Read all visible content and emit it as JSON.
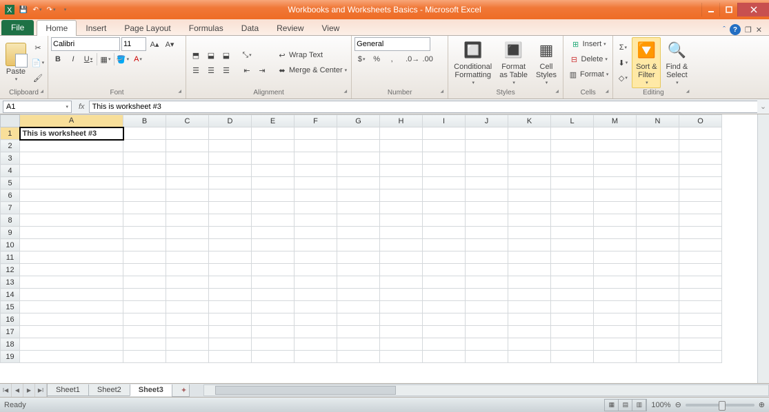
{
  "title": "Workbooks and Worksheets Basics - Microsoft Excel",
  "tabs": {
    "file": "File",
    "home": "Home",
    "insert": "Insert",
    "pagelayout": "Page Layout",
    "formulas": "Formulas",
    "data": "Data",
    "review": "Review",
    "view": "View"
  },
  "ribbon": {
    "clipboard": {
      "label": "Clipboard",
      "paste": "Paste"
    },
    "font": {
      "label": "Font",
      "name": "Calibri",
      "size": "11",
      "b": "B",
      "i": "I",
      "u": "U"
    },
    "alignment": {
      "label": "Alignment",
      "wrap": "Wrap Text",
      "merge": "Merge & Center"
    },
    "number": {
      "label": "Number",
      "format": "General",
      "currency": "$",
      "percent": "%",
      "comma": ","
    },
    "styles": {
      "label": "Styles",
      "cond": "Conditional\nFormatting",
      "table": "Format\nas Table",
      "cell": "Cell\nStyles"
    },
    "cells": {
      "label": "Cells",
      "insert": "Insert",
      "delete": "Delete",
      "format": "Format"
    },
    "editing": {
      "label": "Editing",
      "sort": "Sort &\nFilter",
      "find": "Find &\nSelect"
    }
  },
  "namebox": "A1",
  "formula": "This is worksheet #3",
  "columns": [
    "A",
    "B",
    "C",
    "D",
    "E",
    "F",
    "G",
    "H",
    "I",
    "J",
    "K",
    "L",
    "M",
    "N",
    "O"
  ],
  "rows": [
    "1",
    "2",
    "3",
    "4",
    "5",
    "6",
    "7",
    "8",
    "9",
    "10",
    "11",
    "12",
    "13",
    "14",
    "15",
    "16",
    "17",
    "18",
    "19"
  ],
  "cellA1": "This is worksheet #3",
  "sheets": {
    "s1": "Sheet1",
    "s2": "Sheet2",
    "s3": "Sheet3"
  },
  "status": {
    "ready": "Ready",
    "zoom": "100%"
  }
}
